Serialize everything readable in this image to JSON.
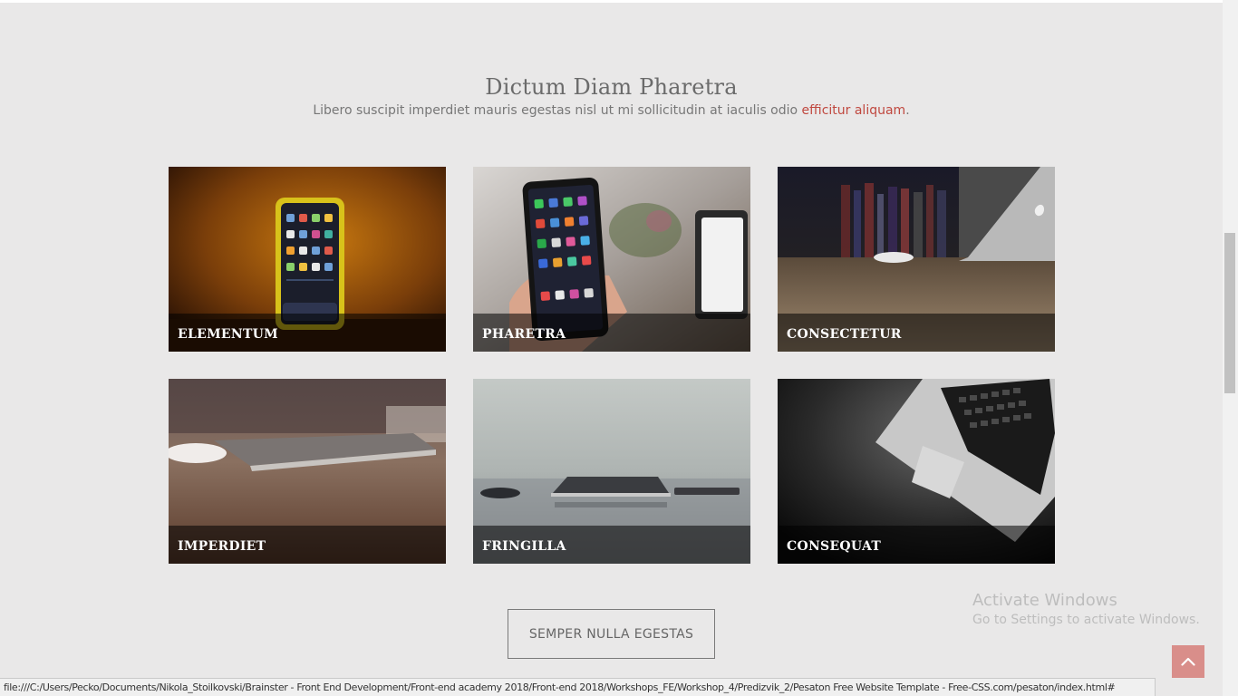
{
  "section": {
    "title": "Dictum Diam Pharetra",
    "subtitle_text": "Libero suscipit imperdiet mauris egestas nisl ut mi sollicitudin at iaculis odio ",
    "subtitle_link": "efficitur aliquam",
    "subtitle_end": "."
  },
  "cards": [
    {
      "label": "ELEMENTUM"
    },
    {
      "label": "PHARETRA"
    },
    {
      "label": "CONSECTETUR"
    },
    {
      "label": "IMPERDIET"
    },
    {
      "label": "FRINGILLA"
    },
    {
      "label": "CONSEQUAT"
    }
  ],
  "button": {
    "label": "SEMPER NULLA EGESTAS"
  },
  "watermark": {
    "line1": "Activate Windows",
    "line2": "Go to Settings to activate Windows."
  },
  "status_url": "file:///C:/Users/Pecko/Documents/Nikola_Stoilkovski/Brainster - Front End Development/Front-end academy 2018/Front-end 2018/Workshops_FE/Workshop_4/Predizvik_2/Pesaton Free Website Template - Free-CSS.com/pesaton/index.html#",
  "colors": {
    "accent": "#c0483f",
    "back_to_top": "#d98e8a",
    "page_bg": "#e9e8e8"
  },
  "icons": {
    "back_to_top": "chevron-up-icon"
  }
}
